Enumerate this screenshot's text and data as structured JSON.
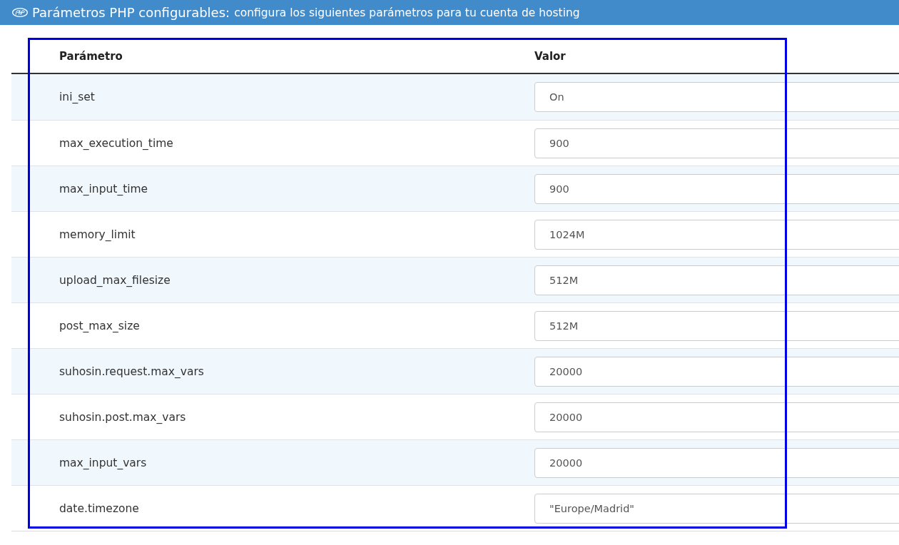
{
  "header": {
    "title": "Parámetros PHP configurables:",
    "subtitle": "configura los siguientes parámetros para tu cuenta de hosting"
  },
  "table": {
    "columns": [
      "Parámetro",
      "Valor"
    ],
    "rows": [
      {
        "parameter": "ini_set",
        "value": "On"
      },
      {
        "parameter": "max_execution_time",
        "value": "900"
      },
      {
        "parameter": "max_input_time",
        "value": "900"
      },
      {
        "parameter": "memory_limit",
        "value": "1024M"
      },
      {
        "parameter": "upload_max_filesize",
        "value": "512M"
      },
      {
        "parameter": "post_max_size",
        "value": "512M"
      },
      {
        "parameter": "suhosin.request.max_vars",
        "value": "20000"
      },
      {
        "parameter": "suhosin.post.max_vars",
        "value": "20000"
      },
      {
        "parameter": "max_input_vars",
        "value": "20000"
      },
      {
        "parameter": "date.timezone",
        "value": "\"Europe/Madrid\""
      }
    ]
  }
}
